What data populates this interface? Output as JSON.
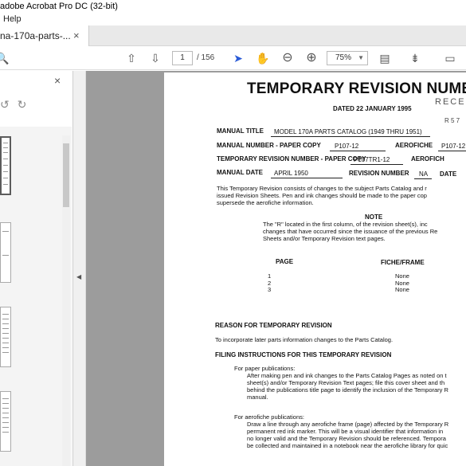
{
  "window": {
    "title": "adobe Acrobat Pro DC (32-bit)"
  },
  "menu": {
    "help": "Help"
  },
  "tab": {
    "label": "na-170a-parts-...",
    "close": "×"
  },
  "toolbar": {
    "page_current": "1",
    "page_total": "/ 156",
    "zoom": "75%"
  },
  "icons": {
    "zoom": "🔍",
    "prev": "⇧",
    "next": "⇩",
    "select": "➤",
    "hand": "✋",
    "zoom_out": "⊖",
    "zoom_in": "⊕",
    "page_view": "▤",
    "scroll_mode": "⇟",
    "comment": "▭",
    "panel_close": "×",
    "undo": "↺",
    "redo": "↻",
    "collapse": "◀"
  },
  "document": {
    "title": "TEMPORARY REVISION NUMBE",
    "dated": "DATED  22 JANUARY 1995",
    "received_stamp": "RECEI",
    "stamp_code": "R 5 7",
    "manual_title_label": "MANUAL TITLE",
    "manual_title_value": "MODEL 170A PARTS CATALOG (1949 THRU 1951)",
    "manual_number_label": "MANUAL NUMBER - PAPER COPY",
    "manual_number_value": "P107-12",
    "aerofiche_label": "AEROFICHE",
    "aerofiche_value": "P107-12",
    "trn_label": "TEMPORARY REVISION NUMBER - PAPER COPY",
    "trn_value": "P107TR1-12",
    "aerofich_label2": "AEROFICH",
    "manual_date_label": "MANUAL DATE",
    "manual_date_value": "APRIL 1950",
    "revision_number_label": "REVISION NUMBER",
    "revision_number_value": "NA",
    "date_label": "DATE",
    "intro_l1": "This Temporary Revision consists of changes to the subject Parts Catalog and r",
    "intro_l2": "issued Revision Sheets.  Pen and ink changes should be made to the paper cop",
    "intro_l3": "supersede the aerofiche information.",
    "note_heading": "NOTE",
    "note_l1": "The \"R\" located in the first column, of the revision sheet(s), inc",
    "note_l2": "changes that have occurred since the issuance of the previous Re",
    "note_l3": "Sheets and/or Temporary Revision text pages.",
    "col_page": "PAGE",
    "col_fiche": "FICHE/FRAME",
    "rows": [
      {
        "page": "1",
        "fiche": "None"
      },
      {
        "page": "2",
        "fiche": "None"
      },
      {
        "page": "3",
        "fiche": "None"
      }
    ],
    "reason_heading": "REASON FOR TEMPORARY REVISION",
    "reason_text": "To incorporate later parts information changes to the Parts Catalog.",
    "filing_heading": "FILING INSTRUCTIONS FOR THIS TEMPORARY REVISION",
    "paper_heading": "For paper publications:",
    "paper_l1": "After making pen and ink changes to the Parts Catalog Pages as noted on t",
    "paper_l2": "sheet(s) and/or Temporary Revision Text pages;  file this cover sheet and th",
    "paper_l3": "behind the publications title page to identify the inclusion of the Temporary R",
    "paper_l4": "manual.",
    "aero_heading": "For aerofiche publications:",
    "aero_l1": "Draw a line through any aerofiche frame (page) affected by the Temporary R",
    "aero_l2": "permanent red ink marker.  This will be a visual identifier that information in",
    "aero_l3": "no longer valid and the Temporary Revision should be referenced.  Tempora",
    "aero_l4": "be collected and maintained in a notebook near the aerofiche library for quic"
  }
}
